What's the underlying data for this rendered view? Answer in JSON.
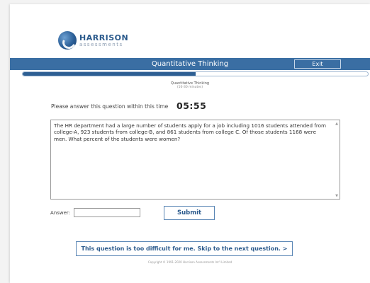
{
  "logo": {
    "name": "HARRISON",
    "sub": "assessments"
  },
  "header": {
    "title": "Quantitative Thinking",
    "exit_label": "Exit"
  },
  "progress": {
    "fraction": 0.5,
    "fill_color": "#2d5f93"
  },
  "section": {
    "line1": "Quantitative Thinking",
    "line2": "(10-30 minutes)"
  },
  "timer": {
    "label": "Please answer this question within this time",
    "value": "05:55"
  },
  "question": {
    "text": "The HR department had a large number of students apply for a job including 1016 students attended from college-A, 923 students from college-B, and 861 students from college C. Of those students 1168 were men. What percent of the students were women?"
  },
  "answer": {
    "label": "Answer:",
    "value": ""
  },
  "submit": {
    "label": "Submit"
  },
  "skip": {
    "label": "This question is too difficult for me. Skip to the next question. >"
  },
  "footer": {
    "copyright": "Copyright © 1991-2020 Harrison Assessments Int'l Limited"
  },
  "colors": {
    "brand_blue": "#3a6ea3",
    "button_text": "#2b5a8c"
  }
}
